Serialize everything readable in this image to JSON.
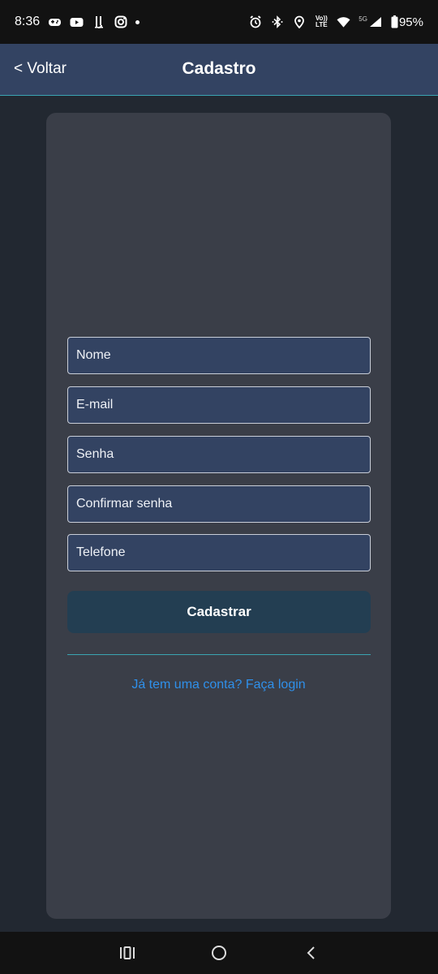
{
  "status_bar": {
    "time": "8:36",
    "battery_percent": "95%",
    "network_label": "5G",
    "volte_top": "Vo))",
    "volte_bottom": "LTE"
  },
  "header": {
    "back_label": "< Voltar",
    "title": "Cadastro"
  },
  "form": {
    "fields": [
      {
        "placeholder": "Nome",
        "value": ""
      },
      {
        "placeholder": "E-mail",
        "value": ""
      },
      {
        "placeholder": "Senha",
        "value": ""
      },
      {
        "placeholder": "Confirmar senha",
        "value": ""
      },
      {
        "placeholder": "Telefone",
        "value": ""
      }
    ],
    "submit_label": "Cadastrar",
    "login_link": "Já tem uma conta? Faça login"
  },
  "nav_bar": {
    "recents_icon": "recents-icon",
    "home_icon": "home-icon",
    "back_icon": "back-chevron-icon"
  },
  "colors": {
    "background": "#222831",
    "header": "#334362",
    "card": "#3a3e48",
    "field": "#334362",
    "button": "#233e52",
    "accent_line": "#3aa4b2",
    "link": "#2f90ea"
  }
}
